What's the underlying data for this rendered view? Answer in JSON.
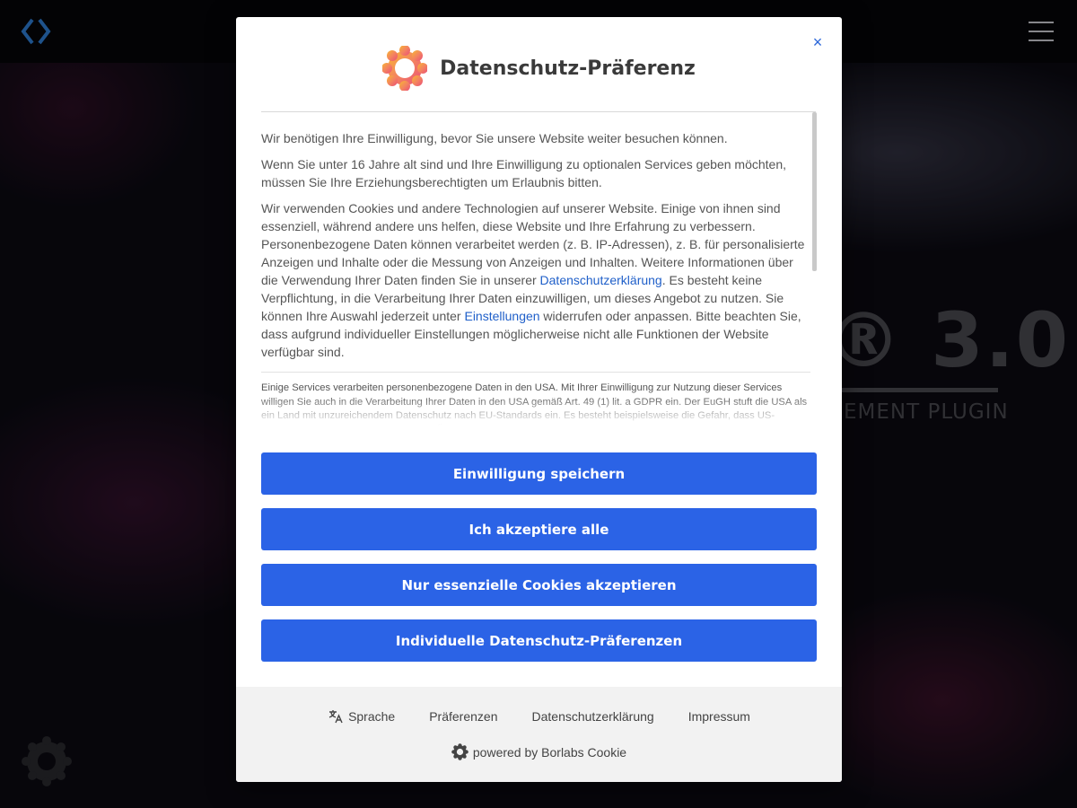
{
  "background": {
    "hero_title": "® 3.0",
    "hero_subtitle": "EMENT PLUGIN",
    "icons": {
      "logo": "code-brackets-icon",
      "menu": "hamburger-menu-icon",
      "floating": "borlabs-cookie-icon"
    }
  },
  "dialog": {
    "title": "Datenschutz-Präferenz",
    "close_label": "×",
    "intro_1": "Wir benötigen Ihre Einwilligung, bevor Sie unsere Website weiter besuchen können.",
    "intro_2": "Wenn Sie unter 16 Jahre alt sind und Ihre Einwilligung zu optionalen Services geben möchten, müssen Sie Ihre Erziehungsberechtigten um Erlaubnis bitten.",
    "intro_3_a": "Wir verwenden Cookies und andere Technologien auf unserer Website. Einige von ihnen sind essenziell, während andere uns helfen, diese Website und Ihre Erfahrung zu verbessern. Personenbezogene Daten können verarbeitet werden (z. B. IP-Adressen), z. B. für personalisierte Anzeigen und Inhalte oder die Messung von Anzeigen und Inhalten. Weitere Informationen über die Verwendung Ihrer Daten finden Sie in unserer ",
    "privacy_link": "Datenschutzerklärung",
    "intro_3_b": ". Es besteht keine Verpflichtung, in die Verarbeitung Ihrer Daten einzuwilligen, um dieses Angebot zu nutzen. Sie können Ihre Auswahl jederzeit unter ",
    "settings_link": "Einstellungen",
    "intro_3_c": " widerrufen oder anpassen. Bitte beachten Sie, dass aufgrund individueller Einstellungen möglicherweise nicht alle Funktionen der Website verfügbar sind.",
    "usa_notice": "Einige Services verarbeiten personenbezogene Daten in den USA. Mit Ihrer Einwilligung zur Nutzung dieser Services willigen Sie auch in die Verarbeitung Ihrer Daten in den USA gemäß Art. 49 (1) lit. a GDPR ein. Der EuGH stuft die USA als ein Land mit unzureichendem Datenschutz nach EU-Standards ein. Es besteht beispielsweise die Gefahr, dass US-Behörden personenbezogene Daten in Überwachungsprogrammen verarbeiten, ohne dass für",
    "buttons": {
      "save": "Einwilligung speichern",
      "accept_all": "Ich akzeptiere alle",
      "essential_only": "Nur essenzielle Cookies akzeptieren",
      "individual": "Individuelle Datenschutz-Präferenzen"
    },
    "footer": {
      "language": "Sprache",
      "preferences": "Präferenzen",
      "privacy": "Datenschutzerklärung",
      "imprint": "Impressum",
      "powered_by": "powered by Borlabs Cookie"
    },
    "icons": {
      "brand": "borlabs-cookie-logo-icon",
      "language": "translate-icon",
      "powered": "borlabs-cookie-icon"
    },
    "colors": {
      "primary": "#2b63e6",
      "link": "#1f5fc9",
      "close": "#2a66d9",
      "footer_bg": "#f2f2f2"
    }
  }
}
